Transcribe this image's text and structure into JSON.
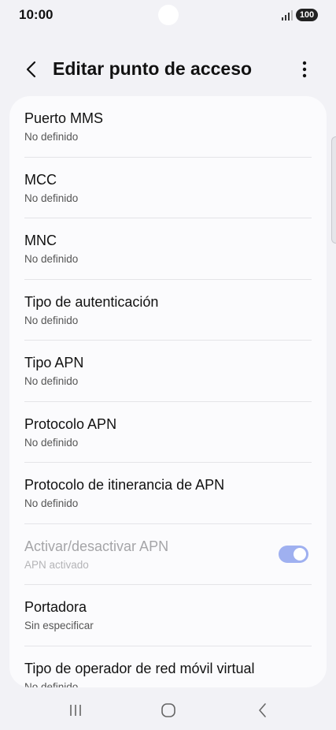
{
  "status_bar": {
    "time": "10:00",
    "battery": "100",
    "signal_icon": "signal-bars-icon"
  },
  "app_bar": {
    "title": "Editar punto de acceso",
    "back_icon": "chevron-left-icon",
    "more_icon": "more-vertical-icon"
  },
  "settings": [
    {
      "title": "Puerto MMS",
      "subtitle": "No definido"
    },
    {
      "title": "MCC",
      "subtitle": "No definido"
    },
    {
      "title": "MNC",
      "subtitle": "No definido"
    },
    {
      "title": "Tipo de autenticación",
      "subtitle": "No definido"
    },
    {
      "title": "Tipo APN",
      "subtitle": "No definido"
    },
    {
      "title": "Protocolo APN",
      "subtitle": "No definido"
    },
    {
      "title": "Protocolo de itinerancia de APN",
      "subtitle": "No definido"
    },
    {
      "title": "Activar/desactivar APN",
      "subtitle": "APN activado",
      "toggle_on": true,
      "disabled": true
    },
    {
      "title": "Portadora",
      "subtitle": "Sin especificar"
    },
    {
      "title": "Tipo de operador de red móvil virtual",
      "subtitle": "No definido"
    }
  ],
  "colors": {
    "background": "#f2f2f6",
    "card": "#fbfbfd",
    "toggle_on": "#9fb0f0"
  },
  "nav_bar": {
    "recents_icon": "recents-icon",
    "home_icon": "home-icon",
    "back_icon": "back-icon"
  }
}
